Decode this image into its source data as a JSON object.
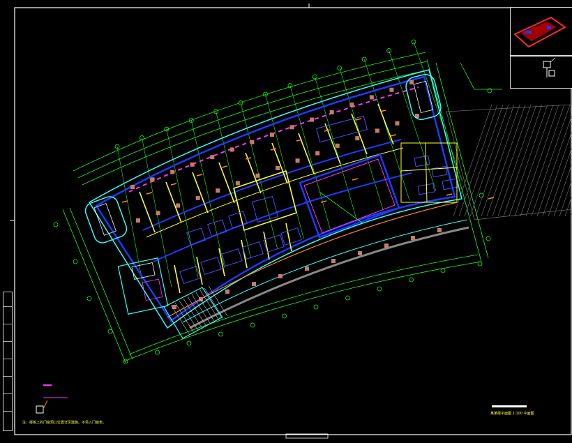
{
  "drawing": {
    "type": "CAD floor plan (overview)",
    "colors": {
      "background": "#000000",
      "border": "#ffffff",
      "gridline": "#19ff19",
      "wall": "#1a3cff",
      "column": "#c87a6a",
      "partition": "#ffff33",
      "accent_cyan": "#33ffff",
      "magenta": "#ff33ff",
      "hatch": "#9a9a9a",
      "orange": "#ff8a1a"
    }
  },
  "annotations": {
    "scale_title": "某某楼平面图 1:100 平面图",
    "general_note": "注：楼板上的门窗洞口位置详见建施。不另入门窗表。"
  },
  "icons": {
    "north_arrow": "north-arrow-icon",
    "key_plan": "key-plan-icon"
  }
}
